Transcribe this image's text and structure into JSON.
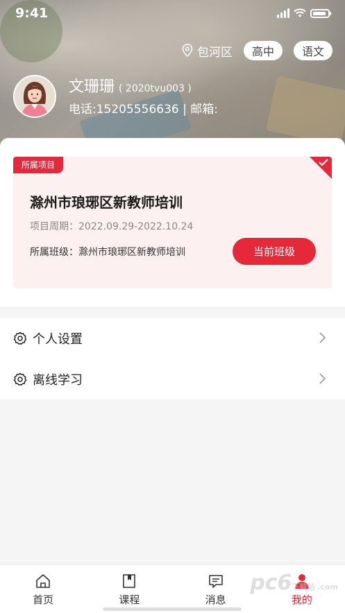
{
  "status": {
    "time": "9:41"
  },
  "header": {
    "location": "包河区",
    "level": "高中",
    "subject": "语文"
  },
  "user": {
    "name": "文珊珊",
    "code": "( 2020tvu003 )",
    "contact": "电话:15205556636  |  邮箱:"
  },
  "project": {
    "tag": "所属项目",
    "title": "滁州市琅琊区新教师培训",
    "period": "项目周期：2022.09.29-2022.10.24",
    "class_line": "所属班级：滁州市琅琊区新教师培训",
    "button": "当前班级"
  },
  "menu": {
    "items": [
      {
        "label": "个人设置",
        "icon": "gear-icon"
      },
      {
        "label": "离线学习",
        "icon": "gear-icon"
      }
    ]
  },
  "tabbar": {
    "items": [
      {
        "label": "首页",
        "icon": "home-icon"
      },
      {
        "label": "课程",
        "icon": "book-icon"
      },
      {
        "label": "消息",
        "icon": "message-icon"
      },
      {
        "label": "我的",
        "icon": "user-icon"
      }
    ],
    "active": "我的"
  },
  "watermark": {
    "main": "pc6",
    "sub": "下载站 .com"
  },
  "colors": {
    "accent": "#e6283b",
    "card_bg": "#fdf0f1"
  }
}
